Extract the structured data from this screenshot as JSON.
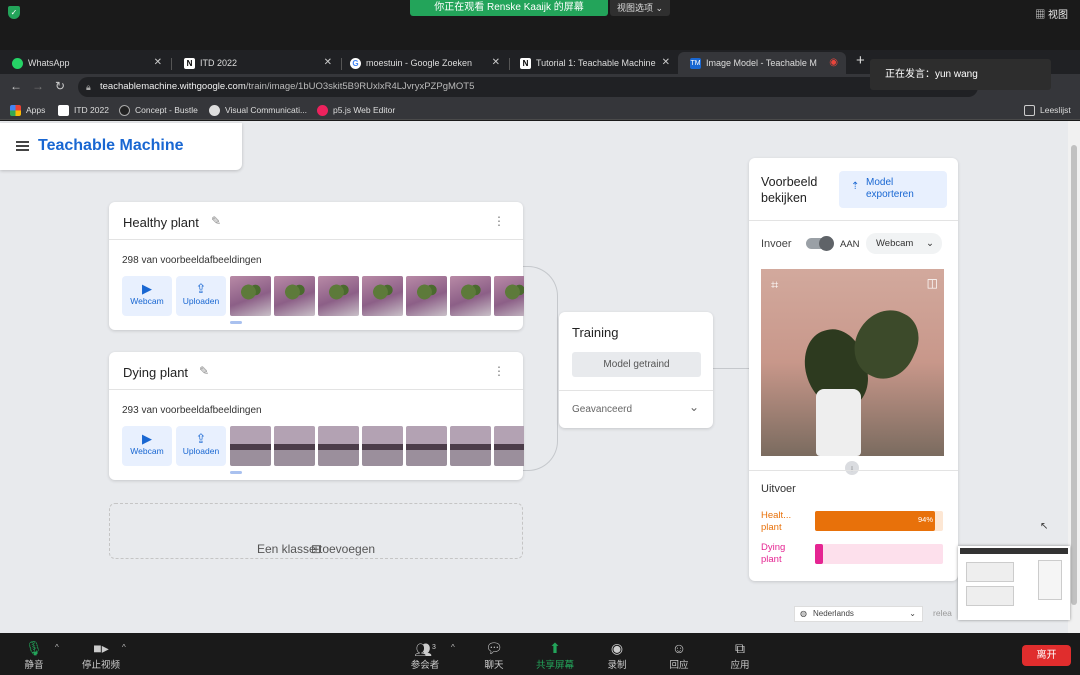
{
  "zoom_top": {
    "share_banner": "你正在观看 Renske Kaaijk 的屏幕",
    "view_options": "视图选项 ⌄",
    "view_button": "视图"
  },
  "browser": {
    "tabs": [
      {
        "label": "WhatsApp",
        "icon": "whatsapp-icon",
        "color": "#25d366"
      },
      {
        "label": "ITD 2022",
        "icon": "notion-icon",
        "color": "#000000"
      },
      {
        "label": "moestuin - Google Zoeken",
        "icon": "google-icon",
        "color": "#4285f4"
      },
      {
        "label": "Tutorial 1: Teachable Machine",
        "icon": "notion-icon",
        "color": "#000000"
      },
      {
        "label": "Image Model - Teachable M",
        "icon": "teachable-machine-icon",
        "color": "#1967d2"
      }
    ],
    "url_domain": "teachablemachine.withgoogle.com",
    "url_path": "/train/image/1bUO3skit5B9RUxlxR4LJvryxPZPgMOT5",
    "bookmarks": [
      "Apps",
      "ITD 2022",
      "Concept - Bustle",
      "Visual Communicati...",
      "p5.js Web Editor"
    ],
    "reading_list": "Leeslijst"
  },
  "speaker_popup": "正在发言：yun wang",
  "app": {
    "title": "Teachable Machine",
    "classes": [
      {
        "name": "Healthy plant",
        "count": "298 van voorbeeldafbeeldingen"
      },
      {
        "name": "Dying plant",
        "count": "293 van voorbeeldafbeeldingen"
      }
    ],
    "webcam_label": "Webcam",
    "upload_label": "Uploaden",
    "add_class": "Een klasse toevoegen",
    "training": {
      "title": "Training",
      "trained_button": "Model getraind",
      "advanced": "Geavanceerd"
    },
    "preview": {
      "title_line1": "Voorbeeld",
      "title_line2": "bekijken",
      "export_line1": "Model",
      "export_line2": "exporteren",
      "input_label": "Invoer",
      "toggle_state": "AAN",
      "source": "Webcam",
      "output_label": "Uitvoer",
      "outputs": [
        {
          "label_line1": "Healt...",
          "label_line2": "plant",
          "percent": "94%",
          "value": 94,
          "color": "#e8710a",
          "bg": "#fde7d4"
        },
        {
          "label_line1": "Dying",
          "label_line2": "plant",
          "percent": "",
          "value": 6,
          "color": "#e52592",
          "bg": "#fde0ec"
        }
      ]
    },
    "language": "Nederlands",
    "release_text": "relea"
  },
  "zoom_bottom": {
    "mute": "静音",
    "stop_video": "停止视频",
    "participants": "参会者",
    "participant_count": "3",
    "chat": "聊天",
    "share": "共享屏幕",
    "record": "录制",
    "reactions": "回应",
    "apps": "应用",
    "leave": "离开"
  }
}
